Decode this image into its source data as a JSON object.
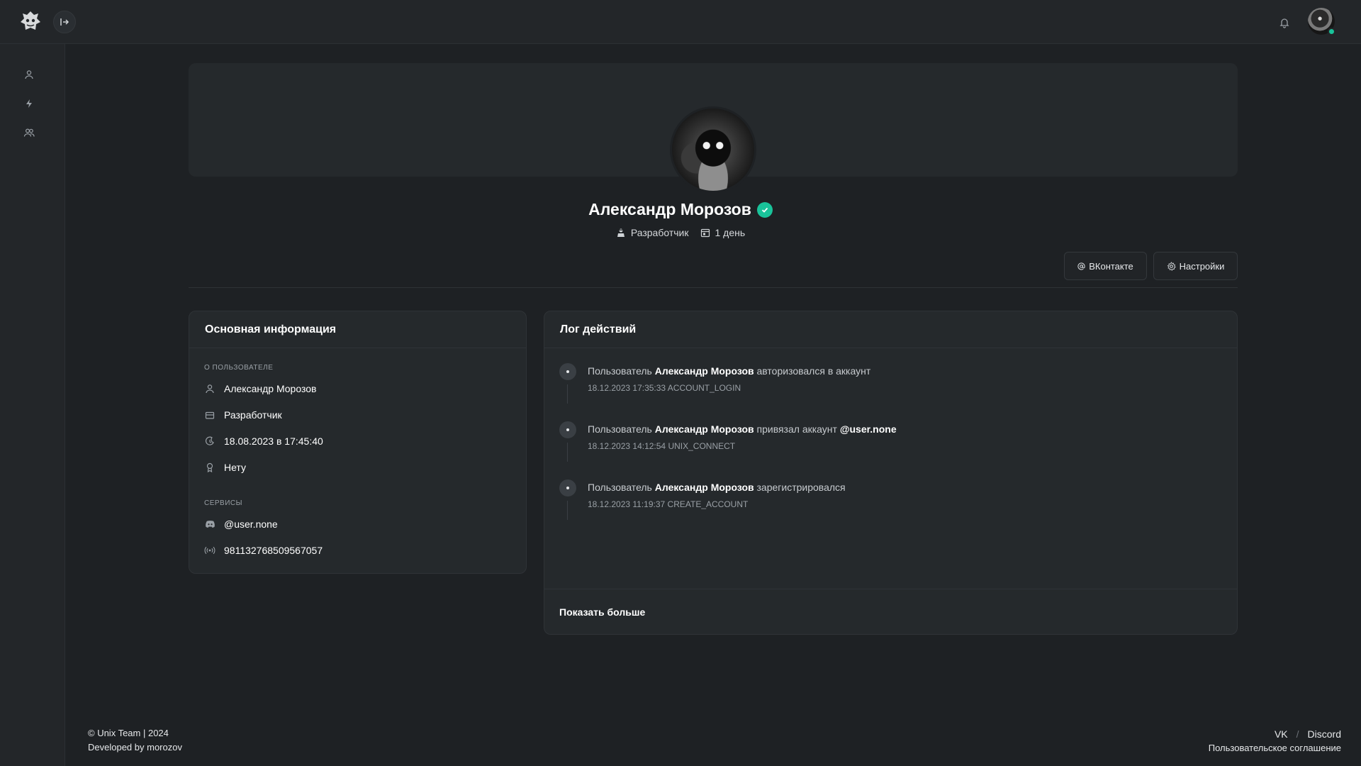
{
  "profile": {
    "name": "Александр Морозов",
    "role": "Разработчик",
    "duration": "1 день"
  },
  "actions": {
    "vk_label": "ВКонтакте",
    "settings_label": "Настройки"
  },
  "info_card": {
    "title": "Основная информация",
    "about_label": "О пользователе",
    "rows": [
      {
        "icon": "user-icon",
        "value": "Александр Морозов"
      },
      {
        "icon": "briefcase-icon",
        "value": "Разработчик"
      },
      {
        "icon": "moon-clock-icon",
        "value": "18.08.2023 в 17:45:40"
      },
      {
        "icon": "award-icon",
        "value": "Нету"
      }
    ],
    "services_label": "Сервисы",
    "services": [
      {
        "icon": "discord-icon",
        "value": "@user.none"
      },
      {
        "icon": "broadcast-icon",
        "value": "981132768509567057"
      }
    ]
  },
  "log_card": {
    "title": "Лог действий",
    "entries": [
      {
        "prefix": "Пользователь",
        "user": "Александр Морозов",
        "action": "авторизовался в аккаунт",
        "target": "",
        "meta": "18.12.2023 17:35:33 ACCOUNT_LOGIN"
      },
      {
        "prefix": "Пользователь",
        "user": "Александр Морозов",
        "action": "привязал аккаунт",
        "target": "@user.none",
        "meta": "18.12.2023 14:12:54 UNIX_CONNECT"
      },
      {
        "prefix": "Пользователь",
        "user": "Александр Морозов",
        "action": "зарегистрировался",
        "target": "",
        "meta": "18.12.2023 11:19:37 CREATE_ACCOUNT"
      }
    ],
    "show_more": "Показать больше"
  },
  "footer": {
    "copyright": "© Unix Team | 2024",
    "developed": "Developed by morozov",
    "link_vk": "VK",
    "separator": "/",
    "link_discord": "Discord",
    "agreement": "Пользовательское соглашение"
  },
  "colors": {
    "background": "#1e2124",
    "panel": "#25292c",
    "accent": "#19c39a"
  }
}
